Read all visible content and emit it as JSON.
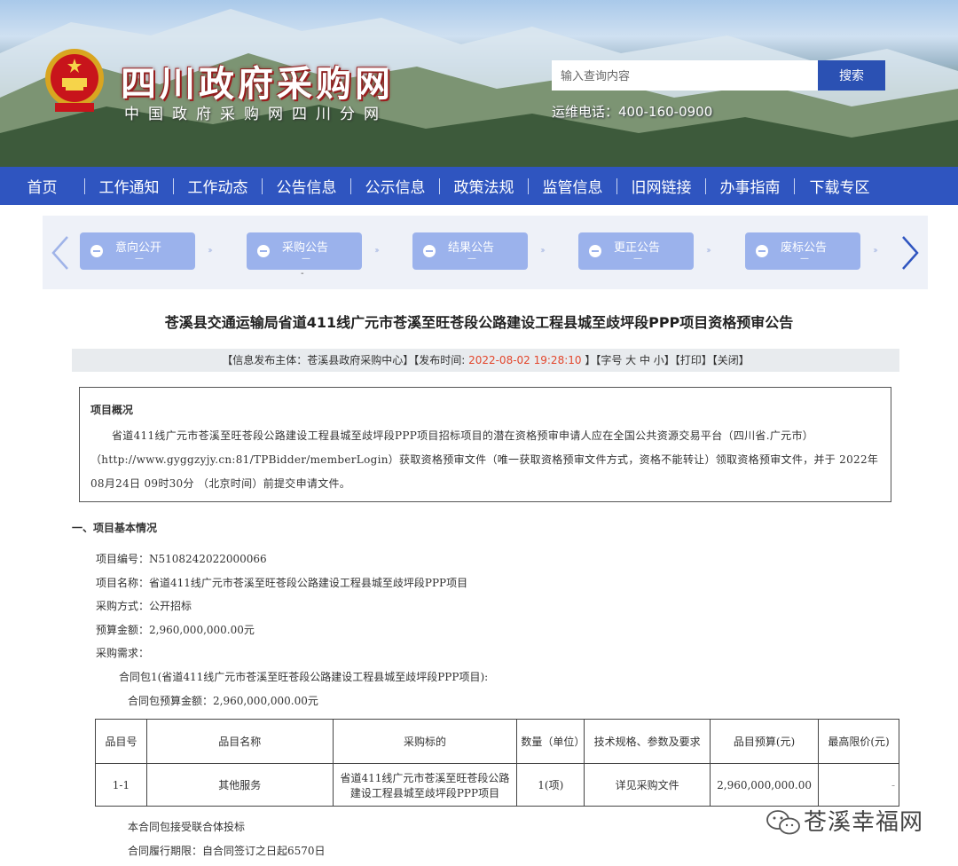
{
  "header": {
    "site_title": "四川政府采购网",
    "site_subtitle": "中国政府采购网四川分网",
    "search_placeholder": "输入查询内容",
    "search_button": "搜索",
    "hotline": "运维电话：400-160-0900"
  },
  "nav": {
    "items": [
      "首页",
      "工作通知",
      "工作动态",
      "公告信息",
      "公示信息",
      "政策法规",
      "监管信息",
      "旧网链接",
      "办事指南",
      "下载专区"
    ]
  },
  "steps": {
    "items": [
      {
        "label": "意向公开",
        "sub": "—"
      },
      {
        "label": "采购公告",
        "sub": "—"
      },
      {
        "label": "结果公告",
        "sub": "—"
      },
      {
        "label": "更正公告",
        "sub": "—"
      },
      {
        "label": "废标公告",
        "sub": "—"
      }
    ],
    "marker": "-"
  },
  "article": {
    "title": "苍溪县交通运输局省道411线广元市苍溪至旺苍段公路建设工程县城至歧坪段PPP项目资格预审公告",
    "meta": {
      "publisher_prefix": "【信息发布主体：苍溪县政府采购中心】【发布时间:",
      "publish_time": "2022-08-02 19:28:10",
      "suffix": "】【字号 大 中 小】【打印】【关闭】"
    },
    "overview": {
      "heading": "项目概况",
      "text": "省道411线广元市苍溪至旺苍段公路建设工程县城至歧坪段PPP项目招标项目的潜在资格预审申请人应在全国公共资源交易平台（四川省.广元市）（http://www.gyggzyjy.cn:81/TPBidder/memberLogin）获取资格预审文件（唯一获取资格预审文件方式，资格不能转让）领取资格预审文件，并于 2022年08月24日 09时30分 （北京时间）前提交申请文件。"
    },
    "section1": {
      "heading": "一、项目基本情况",
      "project_no": "项目编号：N5108242022000066",
      "project_name": "项目名称：省道411线广元市苍溪至旺苍段公路建设工程县城至歧坪段PPP项目",
      "method": "采购方式：公开招标",
      "budget": "预算金额：2,960,000,000.00元",
      "requirements": "采购需求：",
      "package": "合同包1(省道411线广元市苍溪至旺苍段公路建设工程县城至歧坪段PPP项目):",
      "package_budget": "合同包预算金额：2,960,000,000.00元"
    },
    "table": {
      "headers": [
        "品目号",
        "品目名称",
        "采购标的",
        "数量（单位）",
        "技术规格、参数及要求",
        "品目预算(元)",
        "最高限价(元)"
      ],
      "rows": [
        [
          "1-1",
          "其他服务",
          "省道411线广元市苍溪至旺苍段公路建设工程县城至歧坪段PPP项目",
          "1(项)",
          "详见采购文件",
          "2,960,000,000.00",
          "-"
        ]
      ]
    },
    "consortium": "本合同包接受联合体投标",
    "period": "合同履行期限：自合同签订之日起6570日"
  },
  "watermark": "苍溪幸福网",
  "colors": {
    "nav_blue": "#2f55c0",
    "search_button": "#2b51b3",
    "step_fill": "#9bb2ec",
    "publish_time": "#e3462c"
  }
}
